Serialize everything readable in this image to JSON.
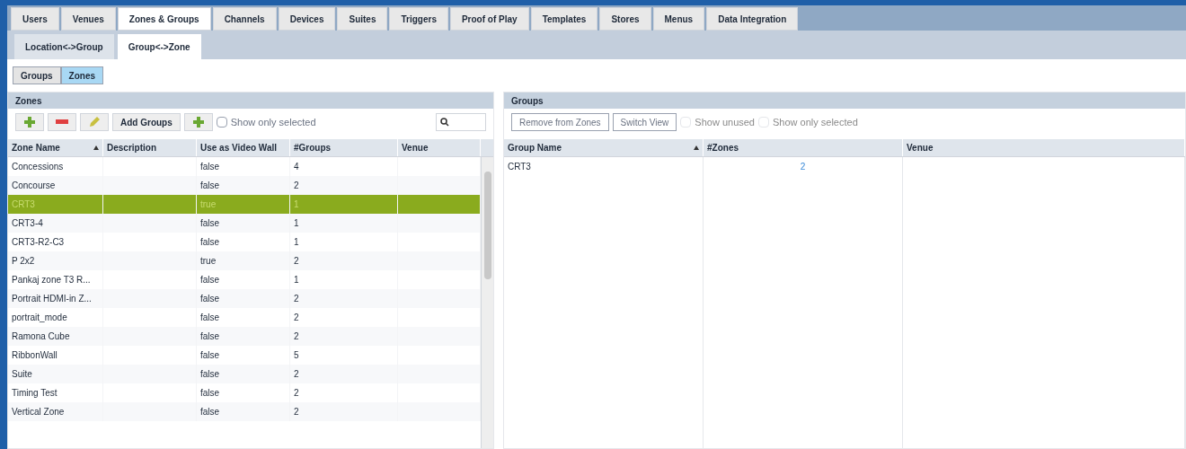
{
  "tabs": [
    {
      "label": "Users",
      "selected": false
    },
    {
      "label": "Venues",
      "selected": false
    },
    {
      "label": "Zones & Groups",
      "selected": true
    },
    {
      "label": "Channels",
      "selected": false
    },
    {
      "label": "Devices",
      "selected": false
    },
    {
      "label": "Suites",
      "selected": false
    },
    {
      "label": "Triggers",
      "selected": false
    },
    {
      "label": "Proof of Play",
      "selected": false
    },
    {
      "label": "Templates",
      "selected": false
    },
    {
      "label": "Stores",
      "selected": false
    },
    {
      "label": "Menus",
      "selected": false
    },
    {
      "label": "Data Integration",
      "selected": false
    }
  ],
  "subtabs": [
    {
      "label": "Location<->Group",
      "selected": false
    },
    {
      "label": "Group<->Zone",
      "selected": true
    }
  ],
  "view_toggle": [
    {
      "label": "Groups",
      "selected": false
    },
    {
      "label": "Zones",
      "selected": true
    }
  ],
  "zones_panel": {
    "title": "Zones",
    "add_groups_button": "Add Groups",
    "show_only_selected": {
      "label": "Show only selected",
      "checked": false
    },
    "columns": [
      "Zone Name",
      "Description",
      "Use as Video Wall",
      "#Groups",
      "Venue"
    ],
    "rows": [
      {
        "cells": [
          "Concessions",
          "",
          "false",
          "4",
          ""
        ],
        "selected": false
      },
      {
        "cells": [
          "Concourse",
          "",
          "false",
          "2",
          ""
        ],
        "selected": false
      },
      {
        "cells": [
          "CRT3",
          "",
          "true",
          "1",
          ""
        ],
        "selected": true
      },
      {
        "cells": [
          "CRT3-4",
          "",
          "false",
          "1",
          ""
        ],
        "selected": false
      },
      {
        "cells": [
          "CRT3-R2-C3",
          "",
          "false",
          "1",
          ""
        ],
        "selected": false
      },
      {
        "cells": [
          "P 2x2",
          "",
          "true",
          "2",
          ""
        ],
        "selected": false
      },
      {
        "cells": [
          "Pankaj zone T3 R...",
          "",
          "false",
          "1",
          ""
        ],
        "selected": false
      },
      {
        "cells": [
          "Portrait HDMI-in Z...",
          "",
          "false",
          "2",
          ""
        ],
        "selected": false
      },
      {
        "cells": [
          "portrait_mode",
          "",
          "false",
          "2",
          ""
        ],
        "selected": false
      },
      {
        "cells": [
          "Ramona Cube",
          "",
          "false",
          "2",
          ""
        ],
        "selected": false
      },
      {
        "cells": [
          "RibbonWall",
          "",
          "false",
          "5",
          ""
        ],
        "selected": false
      },
      {
        "cells": [
          "Suite",
          "",
          "false",
          "2",
          ""
        ],
        "selected": false
      },
      {
        "cells": [
          "Timing Test",
          "",
          "false",
          "2",
          ""
        ],
        "selected": false
      },
      {
        "cells": [
          "Vertical Zone",
          "",
          "false",
          "2",
          ""
        ],
        "selected": false
      }
    ]
  },
  "groups_panel": {
    "title": "Groups",
    "buttons": [
      "Remove from Zones",
      "Switch View"
    ],
    "checkboxes": [
      {
        "label": "Show unused",
        "checked": false,
        "disabled": true
      },
      {
        "label": "Show only selected",
        "checked": false,
        "disabled": true
      }
    ],
    "columns": [
      "Group Name",
      "#Zones",
      "Venue"
    ],
    "rows": [
      {
        "cells": [
          "CRT3",
          "2",
          ""
        ]
      }
    ]
  }
}
